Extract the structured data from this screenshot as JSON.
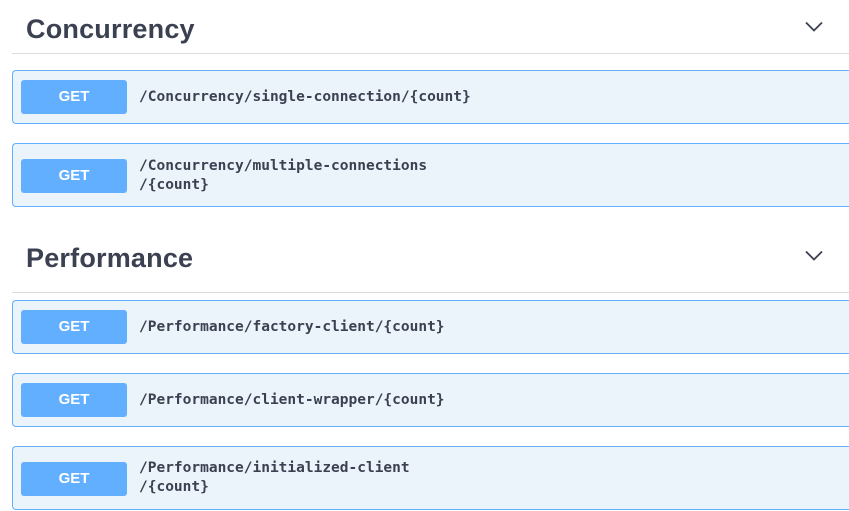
{
  "sections": [
    {
      "title": "Concurrency",
      "operations": [
        {
          "method": "GET",
          "path": "/Concurrency/single-connection/{count}"
        },
        {
          "method": "GET",
          "path": "/Concurrency/multiple-connections\n/{count}"
        }
      ]
    },
    {
      "title": "Performance",
      "operations": [
        {
          "method": "GET",
          "path": "/Performance/factory-client/{count}"
        },
        {
          "method": "GET",
          "path": "/Performance/client-wrapper/{count}"
        },
        {
          "method": "GET",
          "path": "/Performance/initialized-client\n/{count}"
        }
      ]
    }
  ],
  "colors": {
    "get_accent": "#61affe",
    "get_background": "#ebf3fb",
    "title_text": "#3b4151"
  },
  "icons": {
    "section_toggle": "chevron-down-icon"
  }
}
